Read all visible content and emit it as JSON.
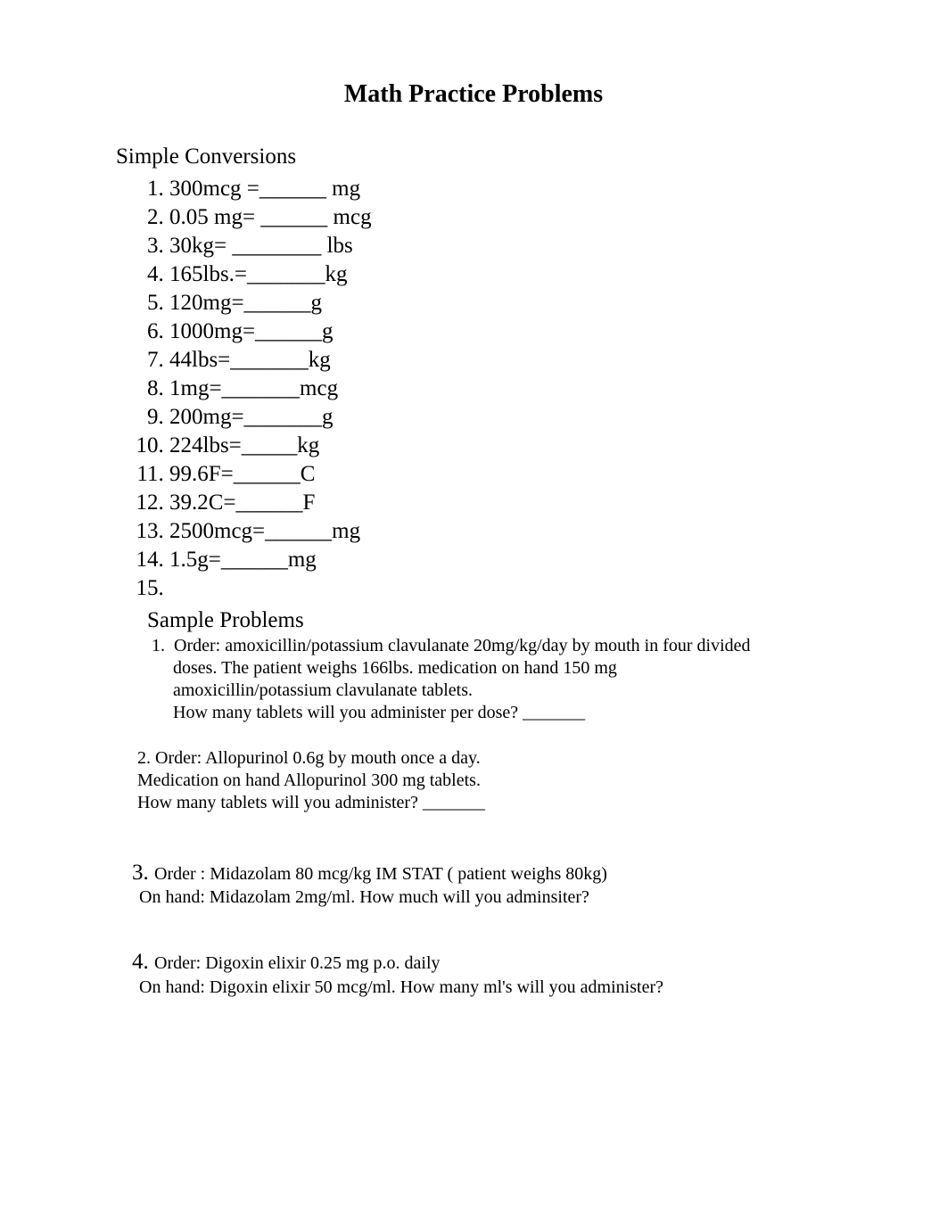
{
  "title": "Math Practice Problems",
  "simpleConversionsHeader": "Simple Conversions",
  "conversions": {
    "i1": "300mcg =______ mg",
    "i2": "0.05 mg= ______ mcg",
    "i3": "30kg= ________ lbs",
    "i4": "165lbs.=_______kg",
    "i5": "120mg=______g",
    "i6": "1000mg=______g",
    "i7": "44lbs=_______kg",
    "i8": "1mg=_______mcg",
    "i9": "200mg=_______g",
    "i10": "224lbs=_____kg",
    "i11": "99.6F=______C",
    "i12": "39.2C=______F",
    "i13": "2500mcg=______mg",
    "i14": "1.5g=______mg",
    "i15": ""
  },
  "sampleHeader": "Sample Problems",
  "sample1": {
    "num": "1.",
    "line1": "Order: amoxicillin/potassium clavulanate 20mg/kg/day by mouth in four divided",
    "line2": "doses. The patient weighs 166lbs. medication on hand 150 mg",
    "line3": "amoxicillin/potassium clavulanate tablets.",
    "line4": "How many tablets will you administer per dose? _______"
  },
  "sample2": {
    "line1": "2. Order: Allopurinol 0.6g by mouth once a day.",
    "line2": " Medication on hand Allopurinol 300 mg tablets.",
    "line3": " How many tablets will you administer? _______"
  },
  "sample3": {
    "num": "3. ",
    "line1": "Order : Midazolam 80 mcg/kg IM STAT ( patient weighs 80kg)",
    "line2": "On hand: Midazolam 2mg/ml. How much will you adminsiter?"
  },
  "sample4": {
    "num": "4. ",
    "line1": "Order: Digoxin elixir 0.25 mg p.o. daily",
    "line2": "On hand: Digoxin elixir 50 mcg/ml. How many ml's will you administer?"
  }
}
